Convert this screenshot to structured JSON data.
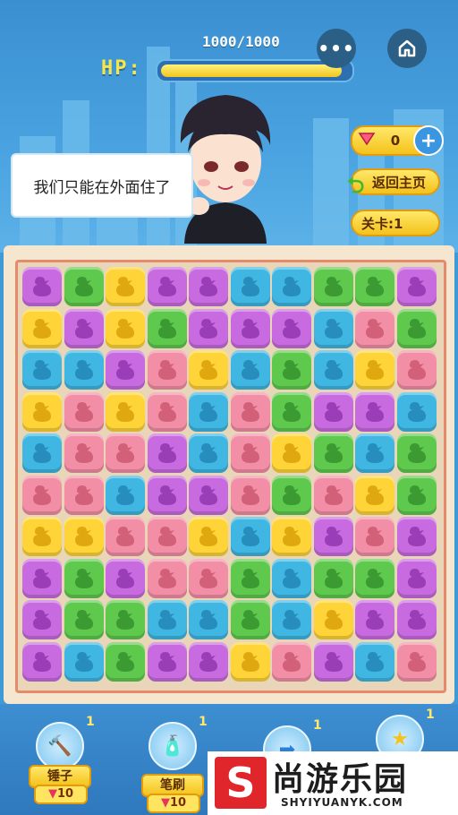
{
  "hud": {
    "hp_label": "HP:",
    "hp_count": "1000/1000",
    "hp_fraction": 0.96,
    "more_icon": "more-dots-icon",
    "home_icon": "home-icon"
  },
  "dialog": {
    "text": "我们只能在外面住了"
  },
  "currency": {
    "value": "0",
    "icon": "gem-icon",
    "add_icon": "plus-icon"
  },
  "buttons": {
    "return_main": "返回主页",
    "level": "关卡:1"
  },
  "colors": {
    "P": "#c86be0",
    "G": "#5fc94e",
    "Y": "#ffd438",
    "B": "#3fb7e2",
    "R": "#f28fa6"
  },
  "board": {
    "rows": [
      "PGYPPBBGGP",
      "YPYGPPPBRG",
      "BBPRYBGBYR",
      "YRYRBRGPPB",
      "BRRPBRYGBG",
      "RRBPPRGRYG",
      "YYRRYBYPRP",
      "PGPRRGBGGP",
      "PGGBBGBYPP",
      "PBGPPYRPBR"
    ]
  },
  "tools": [
    {
      "name": "锤子",
      "cost": "10",
      "qty": "1",
      "icon": "hammer-icon"
    },
    {
      "name": "笔刷",
      "cost": "10",
      "qty": "1",
      "icon": "brush-icon"
    },
    {
      "name": "",
      "cost": "",
      "qty": "1",
      "icon": "arrow-icon"
    },
    {
      "name": "",
      "cost": "",
      "qty": "1",
      "icon": "star-icon"
    }
  ],
  "watermark": {
    "title": "尚游乐园",
    "url": "SHYIYUANYK.COM",
    "logo_letter": "S"
  }
}
